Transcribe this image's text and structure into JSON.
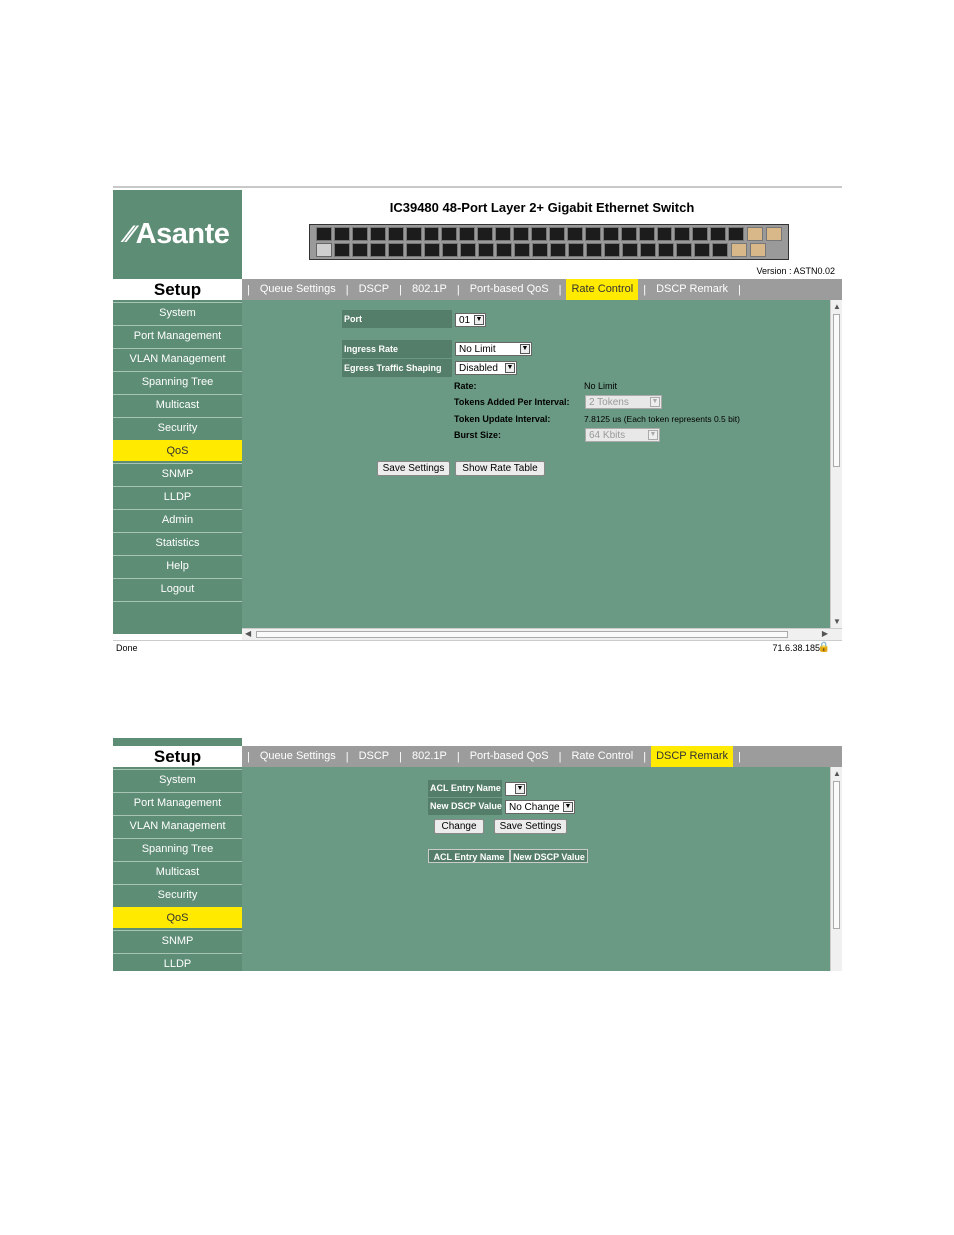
{
  "header": {
    "logo": "Asante",
    "title": "IC39480 48-Port Layer 2+ Gigabit Ethernet Switch",
    "version": "Version : ASTN0.02"
  },
  "sidebar": {
    "title": "Setup",
    "items": [
      "System",
      "Port Management",
      "VLAN Management",
      "Spanning Tree",
      "Multicast",
      "Security",
      "QoS",
      "SNMP",
      "LLDP",
      "Admin",
      "Statistics",
      "Help",
      "Logout"
    ]
  },
  "tabs": [
    "Queue Settings",
    "DSCP",
    "802.1P",
    "Port-based QoS",
    "Rate Control",
    "DSCP Remark"
  ],
  "rate_control": {
    "port_label": "Port",
    "port_value": "01",
    "ingress_label": "Ingress Rate",
    "ingress_value": "No Limit",
    "egress_label": "Egress Traffic Shaping",
    "egress_value": "Disabled",
    "rate_label": "Rate:",
    "rate_value": "No Limit",
    "tokens_label": "Tokens Added Per Interval:",
    "tokens_value": "2 Tokens",
    "interval_label": "Token Update Interval:",
    "interval_value": "7.8125 us (Each token represents 0.5 bit)",
    "burst_label": "Burst Size:",
    "burst_value": "64 Kbits",
    "save_button": "Save Settings",
    "show_button": "Show Rate Table"
  },
  "status_bar": {
    "left": "Done",
    "right": "71.6.38.185"
  },
  "dscp_remark": {
    "acl_label": "ACL Entry Name",
    "acl_value": "",
    "new_dscp_label": "New DSCP Value",
    "new_dscp_value": "No Change",
    "change_button": "Change",
    "save_button": "Save Settings",
    "table_headers": [
      "ACL Entry Name",
      "New DSCP Value"
    ]
  }
}
